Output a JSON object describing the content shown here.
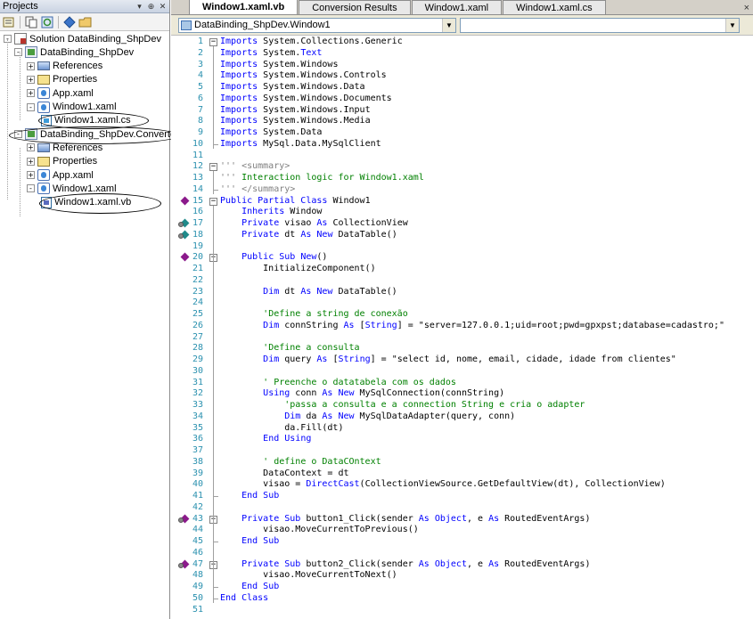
{
  "projects_panel": {
    "title": "Projects",
    "pin_glyph": "▾",
    "autohide_glyph": "⊕",
    "close_glyph": "✕",
    "toolbar_icons": [
      "properties-icon",
      "show-all-files-icon",
      "refresh-icon",
      "view-class-diagram-icon",
      "open-folder-icon"
    ],
    "tree": [
      {
        "label": "Solution DataBinding_ShpDev",
        "icon": "solution-icon",
        "indent": 0,
        "expander": "-"
      },
      {
        "label": "DataBinding_ShpDev",
        "icon": "project-icon",
        "indent": 1,
        "expander": "-"
      },
      {
        "label": "References",
        "icon": "references-icon",
        "indent": 2,
        "expander": "+"
      },
      {
        "label": "Properties",
        "icon": "properties-folder-icon",
        "indent": 2,
        "expander": "+"
      },
      {
        "label": "App.xaml",
        "icon": "xaml-file-icon",
        "indent": 2,
        "expander": "+"
      },
      {
        "label": "Window1.xaml",
        "icon": "xaml-file-icon",
        "indent": 2,
        "expander": "-"
      },
      {
        "label": "Window1.xaml.cs",
        "icon": "cs-file-icon",
        "indent": 3,
        "expander": ""
      },
      {
        "label": "DataBinding_ShpDev.Converted",
        "icon": "project-icon",
        "indent": 1,
        "expander": "-"
      },
      {
        "label": "References",
        "icon": "references-icon",
        "indent": 2,
        "expander": "+"
      },
      {
        "label": "Properties",
        "icon": "properties-folder-icon",
        "indent": 2,
        "expander": "+"
      },
      {
        "label": "App.xaml",
        "icon": "xaml-file-icon",
        "indent": 2,
        "expander": "+"
      },
      {
        "label": "Window1.xaml",
        "icon": "xaml-file-icon",
        "indent": 2,
        "expander": "-"
      },
      {
        "label": "Window1.xaml.vb",
        "icon": "vb-file-icon",
        "indent": 3,
        "expander": ""
      }
    ]
  },
  "editor": {
    "tabs": [
      {
        "label": "Window1.xaml.vb",
        "active": true
      },
      {
        "label": "Conversion Results",
        "active": false
      },
      {
        "label": "Window1.xaml",
        "active": false
      },
      {
        "label": "Window1.xaml.cs",
        "active": false
      }
    ],
    "close_glyph": "×",
    "type_combo": {
      "value": "DataBinding_ShpDev.Window1",
      "arrow": "▼"
    },
    "member_combo": {
      "value": "",
      "arrow": "▼"
    },
    "line_numbers": [
      "1",
      "2",
      "3",
      "4",
      "5",
      "6",
      "7",
      "8",
      "9",
      "10",
      "11",
      "12",
      "13",
      "14",
      "15",
      "16",
      "17",
      "18",
      "19",
      "20",
      "21",
      "22",
      "23",
      "24",
      "25",
      "26",
      "27",
      "28",
      "29",
      "30",
      "31",
      "32",
      "33",
      "34",
      "35",
      "36",
      "37",
      "38",
      "39",
      "40",
      "41",
      "42",
      "43",
      "44",
      "45",
      "46",
      "47",
      "48",
      "49",
      "50",
      "51"
    ],
    "code_lines": [
      [
        {
          "c": "kw",
          "t": "Imports"
        },
        {
          "c": "pl",
          "t": " System.Collections.Generic"
        }
      ],
      [
        {
          "c": "kw",
          "t": "Imports"
        },
        {
          "c": "pl",
          "t": " System."
        },
        {
          "c": "kw",
          "t": "Text"
        }
      ],
      [
        {
          "c": "kw",
          "t": "Imports"
        },
        {
          "c": "pl",
          "t": " System.Windows"
        }
      ],
      [
        {
          "c": "kw",
          "t": "Imports"
        },
        {
          "c": "pl",
          "t": " System.Windows.Controls"
        }
      ],
      [
        {
          "c": "kw",
          "t": "Imports"
        },
        {
          "c": "pl",
          "t": " System.Windows.Data"
        }
      ],
      [
        {
          "c": "kw",
          "t": "Imports"
        },
        {
          "c": "pl",
          "t": " System.Windows.Documents"
        }
      ],
      [
        {
          "c": "kw",
          "t": "Imports"
        },
        {
          "c": "pl",
          "t": " System.Windows.Input"
        }
      ],
      [
        {
          "c": "kw",
          "t": "Imports"
        },
        {
          "c": "pl",
          "t": " System.Windows.Media"
        }
      ],
      [
        {
          "c": "kw",
          "t": "Imports"
        },
        {
          "c": "pl",
          "t": " System.Data"
        }
      ],
      [
        {
          "c": "kw",
          "t": "Imports"
        },
        {
          "c": "pl",
          "t": " MySql.Data.MySqlClient"
        }
      ],
      [],
      [
        {
          "c": "dc",
          "t": "''' <summary>"
        }
      ],
      [
        {
          "c": "dc",
          "t": "''' "
        },
        {
          "c": "cm",
          "t": "Interaction logic for Window1.xaml"
        }
      ],
      [
        {
          "c": "dc",
          "t": "''' </summary>"
        }
      ],
      [
        {
          "c": "kw",
          "t": "Public Partial Class"
        },
        {
          "c": "pl",
          "t": " Window1"
        }
      ],
      [
        {
          "c": "pl",
          "t": "    "
        },
        {
          "c": "kw",
          "t": "Inherits"
        },
        {
          "c": "pl",
          "t": " Window"
        }
      ],
      [
        {
          "c": "pl",
          "t": "    "
        },
        {
          "c": "kw",
          "t": "Private"
        },
        {
          "c": "pl",
          "t": " visao "
        },
        {
          "c": "kw",
          "t": "As"
        },
        {
          "c": "pl",
          "t": " CollectionView"
        }
      ],
      [
        {
          "c": "pl",
          "t": "    "
        },
        {
          "c": "kw",
          "t": "Private"
        },
        {
          "c": "pl",
          "t": " dt "
        },
        {
          "c": "kw",
          "t": "As New"
        },
        {
          "c": "pl",
          "t": " DataTable()"
        }
      ],
      [],
      [
        {
          "c": "pl",
          "t": "    "
        },
        {
          "c": "kw",
          "t": "Public Sub New"
        },
        {
          "c": "pl",
          "t": "()"
        }
      ],
      [
        {
          "c": "pl",
          "t": "        InitializeComponent()"
        }
      ],
      [],
      [
        {
          "c": "pl",
          "t": "        "
        },
        {
          "c": "kw",
          "t": "Dim"
        },
        {
          "c": "pl",
          "t": " dt "
        },
        {
          "c": "kw",
          "t": "As New"
        },
        {
          "c": "pl",
          "t": " DataTable()"
        }
      ],
      [],
      [
        {
          "c": "pl",
          "t": "        "
        },
        {
          "c": "cm",
          "t": "'Define a string de conexão"
        }
      ],
      [
        {
          "c": "pl",
          "t": "        "
        },
        {
          "c": "kw",
          "t": "Dim"
        },
        {
          "c": "pl",
          "t": " connString "
        },
        {
          "c": "kw",
          "t": "As"
        },
        {
          "c": "pl",
          "t": " ["
        },
        {
          "c": "kw",
          "t": "String"
        },
        {
          "c": "pl",
          "t": "] = "
        },
        {
          "c": "pl",
          "t": "\"server=127.0.0.1;uid=root;pwd=gpxpst;database=cadastro;\""
        }
      ],
      [],
      [
        {
          "c": "pl",
          "t": "        "
        },
        {
          "c": "cm",
          "t": "'Define a consulta"
        }
      ],
      [
        {
          "c": "pl",
          "t": "        "
        },
        {
          "c": "kw",
          "t": "Dim"
        },
        {
          "c": "pl",
          "t": " query "
        },
        {
          "c": "kw",
          "t": "As"
        },
        {
          "c": "pl",
          "t": " ["
        },
        {
          "c": "kw",
          "t": "String"
        },
        {
          "c": "pl",
          "t": "] = "
        },
        {
          "c": "pl",
          "t": "\"select id, nome, email, cidade, idade from clientes\""
        }
      ],
      [],
      [
        {
          "c": "pl",
          "t": "        "
        },
        {
          "c": "cm",
          "t": "' Preenche o datatabela com os dados"
        }
      ],
      [
        {
          "c": "pl",
          "t": "        "
        },
        {
          "c": "kw",
          "t": "Using"
        },
        {
          "c": "pl",
          "t": " conn "
        },
        {
          "c": "kw",
          "t": "As New"
        },
        {
          "c": "pl",
          "t": " MySqlConnection(connString)"
        }
      ],
      [
        {
          "c": "pl",
          "t": "            "
        },
        {
          "c": "cm",
          "t": "'passa a consulta e a connection String e cria o adapter"
        }
      ],
      [
        {
          "c": "pl",
          "t": "            "
        },
        {
          "c": "kw",
          "t": "Dim"
        },
        {
          "c": "pl",
          "t": " da "
        },
        {
          "c": "kw",
          "t": "As New"
        },
        {
          "c": "pl",
          "t": " MySqlDataAdapter(query, conn)"
        }
      ],
      [
        {
          "c": "pl",
          "t": "            da.Fill(dt)"
        }
      ],
      [
        {
          "c": "pl",
          "t": "        "
        },
        {
          "c": "kw",
          "t": "End Using"
        }
      ],
      [],
      [
        {
          "c": "pl",
          "t": "        "
        },
        {
          "c": "cm",
          "t": "' define o DataCOntext"
        }
      ],
      [
        {
          "c": "pl",
          "t": "        DataContext = dt"
        }
      ],
      [
        {
          "c": "pl",
          "t": "        visao = "
        },
        {
          "c": "kw",
          "t": "DirectCast"
        },
        {
          "c": "pl",
          "t": "(CollectionViewSource.GetDefaultView(dt), CollectionView)"
        }
      ],
      [
        {
          "c": "pl",
          "t": "    "
        },
        {
          "c": "kw",
          "t": "End Sub"
        }
      ],
      [],
      [
        {
          "c": "pl",
          "t": "    "
        },
        {
          "c": "kw",
          "t": "Private Sub"
        },
        {
          "c": "pl",
          "t": " button1_Click(sender "
        },
        {
          "c": "kw",
          "t": "As Object"
        },
        {
          "c": "pl",
          "t": ", e "
        },
        {
          "c": "kw",
          "t": "As"
        },
        {
          "c": "pl",
          "t": " RoutedEventArgs)"
        }
      ],
      [
        {
          "c": "pl",
          "t": "        visao.MoveCurrentToPrevious()"
        }
      ],
      [
        {
          "c": "pl",
          "t": "    "
        },
        {
          "c": "kw",
          "t": "End Sub"
        }
      ],
      [],
      [
        {
          "c": "pl",
          "t": "    "
        },
        {
          "c": "kw",
          "t": "Private Sub"
        },
        {
          "c": "pl",
          "t": " button2_Click(sender "
        },
        {
          "c": "kw",
          "t": "As Object"
        },
        {
          "c": "pl",
          "t": ", e "
        },
        {
          "c": "kw",
          "t": "As"
        },
        {
          "c": "pl",
          "t": " RoutedEventArgs)"
        }
      ],
      [
        {
          "c": "pl",
          "t": "        visao.MoveCurrentToNext()"
        }
      ],
      [
        {
          "c": "pl",
          "t": "    "
        },
        {
          "c": "kw",
          "t": "End Sub"
        }
      ],
      [
        {
          "c": "kw",
          "t": "End Class"
        }
      ],
      []
    ]
  },
  "colors": {
    "keyword": "#0000ff",
    "comment": "#008000",
    "doc_comment": "#808080",
    "line_number": "#2b91af",
    "marker_purple": "#8b1a8b",
    "marker_teal": "#1f8a8a"
  }
}
